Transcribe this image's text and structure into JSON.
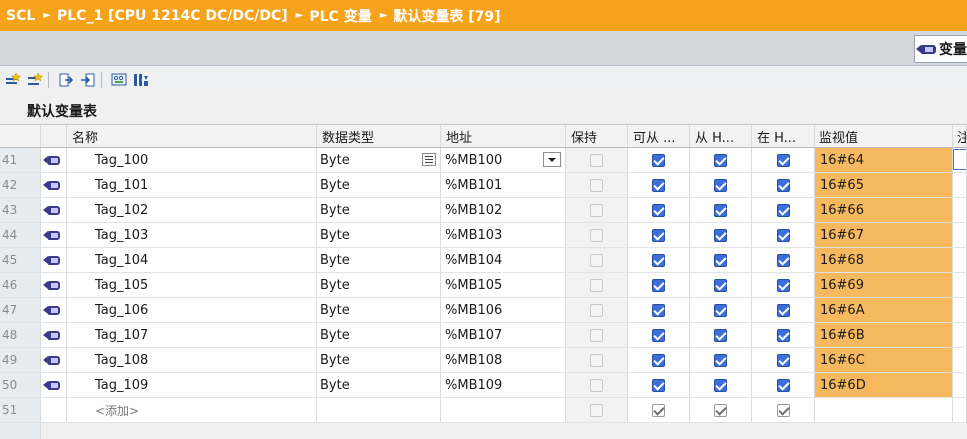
{
  "breadcrumb": [
    "SCL",
    "PLC_1 [CPU 1214C DC/DC/DC]",
    "PLC 变量",
    "默认变量表 [79]"
  ],
  "subtab": {
    "label": "变量"
  },
  "table_title": "默认变量表",
  "columns": {
    "name": "名称",
    "datatype": "数据类型",
    "address": "地址",
    "retain": "保持",
    "accessible": "可从 ...",
    "writable": "从 H...",
    "visible": "在 H...",
    "monitor": "监视值",
    "comment": "注"
  },
  "rows": [
    {
      "num": "41",
      "name": "Tag_100",
      "type": "Byte",
      "address": "%MB100",
      "retain": false,
      "accessible": true,
      "writable": true,
      "visible": true,
      "monitor": "16#64"
    },
    {
      "num": "42",
      "name": "Tag_101",
      "type": "Byte",
      "address": "%MB101",
      "retain": false,
      "accessible": true,
      "writable": true,
      "visible": true,
      "monitor": "16#65"
    },
    {
      "num": "43",
      "name": "Tag_102",
      "type": "Byte",
      "address": "%MB102",
      "retain": false,
      "accessible": true,
      "writable": true,
      "visible": true,
      "monitor": "16#66"
    },
    {
      "num": "44",
      "name": "Tag_103",
      "type": "Byte",
      "address": "%MB103",
      "retain": false,
      "accessible": true,
      "writable": true,
      "visible": true,
      "monitor": "16#67"
    },
    {
      "num": "45",
      "name": "Tag_104",
      "type": "Byte",
      "address": "%MB104",
      "retain": false,
      "accessible": true,
      "writable": true,
      "visible": true,
      "monitor": "16#68"
    },
    {
      "num": "46",
      "name": "Tag_105",
      "type": "Byte",
      "address": "%MB105",
      "retain": false,
      "accessible": true,
      "writable": true,
      "visible": true,
      "monitor": "16#69"
    },
    {
      "num": "47",
      "name": "Tag_106",
      "type": "Byte",
      "address": "%MB106",
      "retain": false,
      "accessible": true,
      "writable": true,
      "visible": true,
      "monitor": "16#6A"
    },
    {
      "num": "48",
      "name": "Tag_107",
      "type": "Byte",
      "address": "%MB107",
      "retain": false,
      "accessible": true,
      "writable": true,
      "visible": true,
      "monitor": "16#6B"
    },
    {
      "num": "49",
      "name": "Tag_108",
      "type": "Byte",
      "address": "%MB108",
      "retain": false,
      "accessible": true,
      "writable": true,
      "visible": true,
      "monitor": "16#6C"
    },
    {
      "num": "50",
      "name": "Tag_109",
      "type": "Byte",
      "address": "%MB109",
      "retain": false,
      "accessible": true,
      "writable": true,
      "visible": true,
      "monitor": "16#6D"
    }
  ],
  "add_row": {
    "num": "51",
    "label": "<添加>"
  },
  "toolbar_icons": [
    "insert-row-icon",
    "add-row-icon",
    "export-icon",
    "import-icon",
    "monitor-all-icon",
    "modify-icon"
  ],
  "colors": {
    "header_bar": "#f7a21b",
    "monitor_cell": "#f7b960",
    "checkbox": "#3c6fd9"
  }
}
